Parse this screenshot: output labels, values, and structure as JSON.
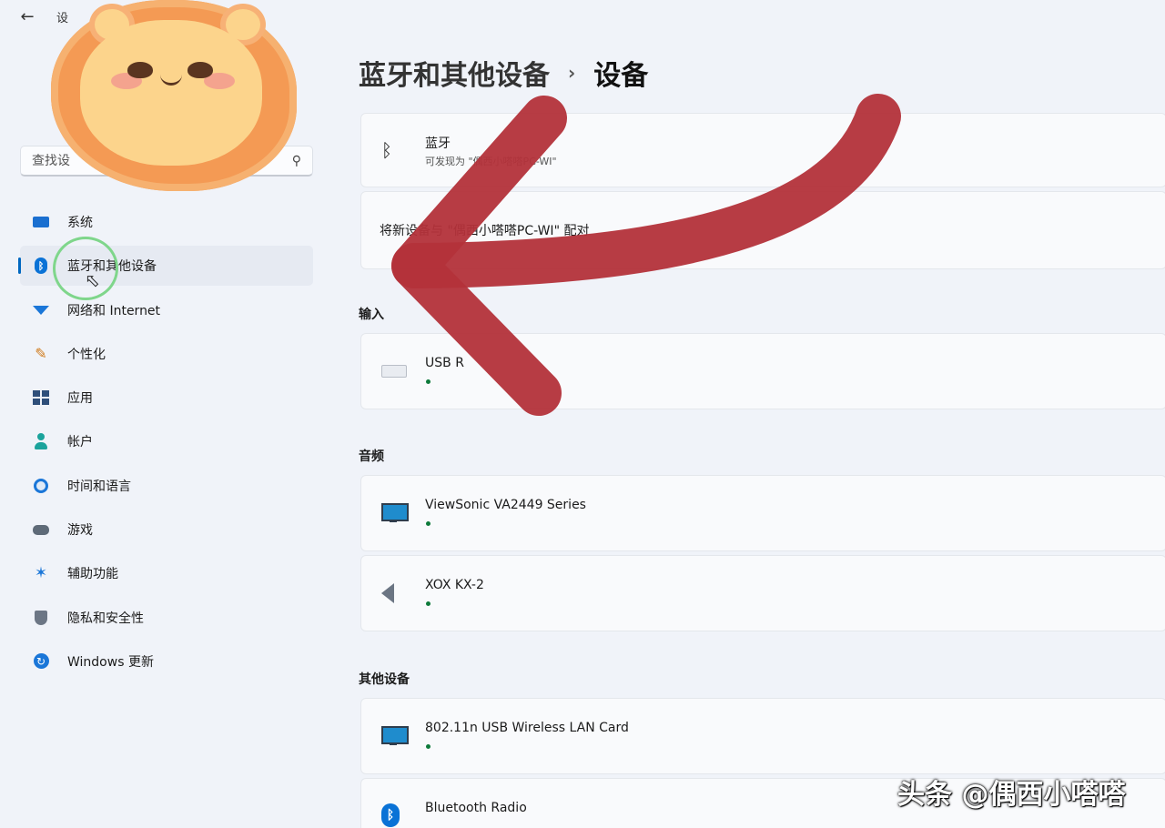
{
  "window": {
    "back_icon": "back-arrow-icon",
    "title": "设"
  },
  "sidebar": {
    "search_placeholder": "查找设",
    "items": [
      {
        "label": "系统",
        "icon": "system-icon"
      },
      {
        "label": "蓝牙和其他设备",
        "icon": "bluetooth-icon",
        "active": true
      },
      {
        "label": "网络和 Internet",
        "icon": "wifi-icon"
      },
      {
        "label": "个性化",
        "icon": "brush-icon"
      },
      {
        "label": "应用",
        "icon": "apps-icon"
      },
      {
        "label": "帐户",
        "icon": "account-icon"
      },
      {
        "label": "时间和语言",
        "icon": "clock-globe-icon"
      },
      {
        "label": "游戏",
        "icon": "gamepad-icon"
      },
      {
        "label": "辅助功能",
        "icon": "accessibility-icon"
      },
      {
        "label": "隐私和安全性",
        "icon": "shield-icon"
      },
      {
        "label": "Windows 更新",
        "icon": "update-icon"
      }
    ]
  },
  "main": {
    "breadcrumb_parent": "蓝牙和其他设备",
    "breadcrumb_current": "设备",
    "bluetooth_card": {
      "title": "蓝牙",
      "subtitle": "可发现为 \"偶西小嗒嗒PC-WI\"",
      "subtitle_visible_tail": "PC-WI"
    },
    "pair_card": {
      "text": "将新设备与 \"偶西小嗒嗒PC-WI\" 配对",
      "visible_prefix": "将新",
      "visible_suffix": "西小嗒嗒PC-WI\"配对"
    },
    "sections": {
      "input": "输入",
      "audio": "音频",
      "other": "其他设备"
    },
    "input_devices": [
      {
        "name": "USB R",
        "icon": "keyboard-icon",
        "connected": true
      }
    ],
    "audio_devices": [
      {
        "name": "ViewSonic VA2449 Series",
        "icon": "monitor-icon",
        "connected": true
      },
      {
        "name": "XOX KX-2",
        "icon": "speaker-icon",
        "connected": true
      }
    ],
    "other_devices": [
      {
        "name": "802.11n USB Wireless LAN Card",
        "icon": "monitor-icon",
        "connected": true
      },
      {
        "name": "Bluetooth Radio",
        "icon": "bluetooth-icon"
      }
    ]
  },
  "overlay": {
    "watermark": "头条 @偶西小嗒嗒",
    "arrow_color": "#b3313a",
    "click_ring_color": "#7fd68b"
  },
  "colors": {
    "accent": "#0067c0",
    "background": "#f0f3f9",
    "card": "#f9fafc",
    "status_green": "#0e7a3b"
  }
}
